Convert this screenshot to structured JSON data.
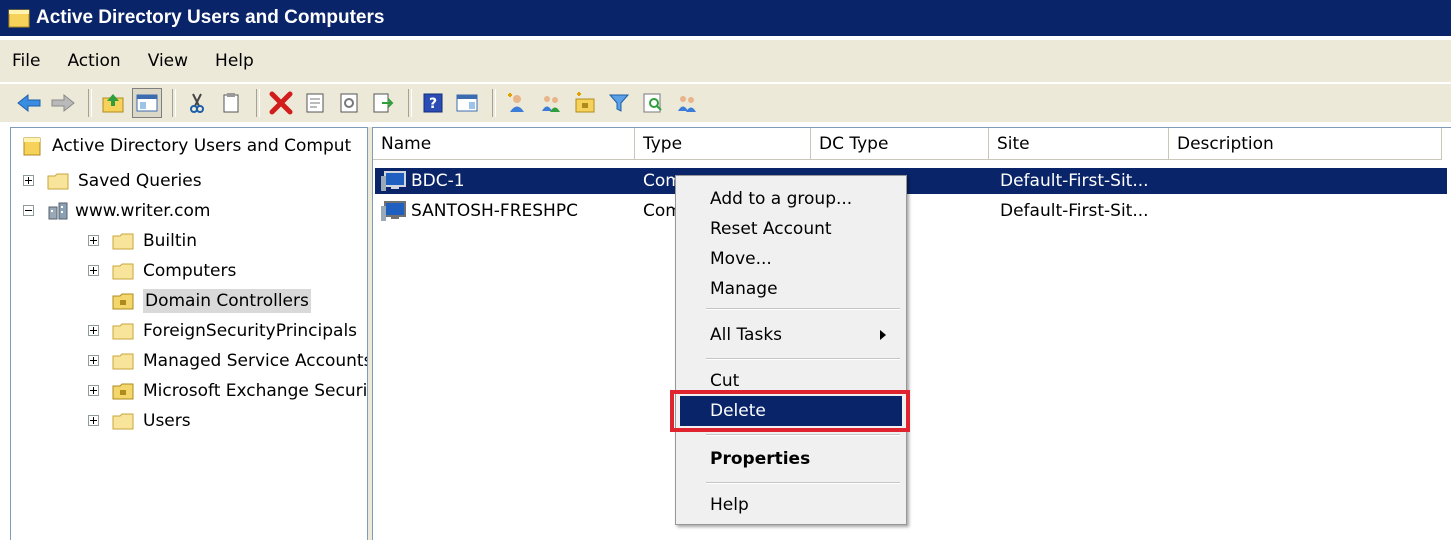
{
  "window": {
    "title": "Active Directory Users and Computers"
  },
  "menu": [
    "File",
    "Action",
    "View",
    "Help"
  ],
  "toolbar": {
    "buttons": [
      "back-arrow-icon",
      "forward-arrow-icon",
      "up-folder-icon",
      "show-console-tree-icon",
      "cut-icon",
      "copy-icon",
      "delete-icon",
      "properties-icon",
      "refresh-icon",
      "export-list-icon",
      "help-icon",
      "show-action-pane-icon",
      "new-user-icon",
      "new-group-icon",
      "new-ou-icon",
      "filter-icon",
      "find-icon",
      "add-to-group-icon"
    ]
  },
  "tree": {
    "root": "Active Directory Users and Comput",
    "items": [
      {
        "label": "Saved Queries"
      },
      {
        "label": "www.writer.com"
      },
      {
        "label": "Builtin"
      },
      {
        "label": "Computers"
      },
      {
        "label": "Domain Controllers"
      },
      {
        "label": "ForeignSecurityPrincipals"
      },
      {
        "label": "Managed Service Accounts"
      },
      {
        "label": "Microsoft Exchange Securit"
      },
      {
        "label": "Users"
      }
    ]
  },
  "list": {
    "columns": [
      "Name",
      "Type",
      "DC Type",
      "Site",
      "Description"
    ],
    "rows": [
      {
        "name": "BDC-1",
        "type": "Com",
        "site": "Default-First-Sit..."
      },
      {
        "name": "SANTOSH-FRESHPC",
        "type": "Com",
        "site": "Default-First-Sit..."
      }
    ]
  },
  "context_menu": {
    "items": [
      "Add to a group...",
      "Reset Account",
      "Move...",
      "Manage",
      "All Tasks",
      "Cut",
      "Delete",
      "Properties",
      "Help"
    ],
    "highlighted": "Delete"
  },
  "colors": {
    "selection": "#0a246a",
    "annotation": "#e0242f",
    "chrome": "#ece9d8"
  }
}
